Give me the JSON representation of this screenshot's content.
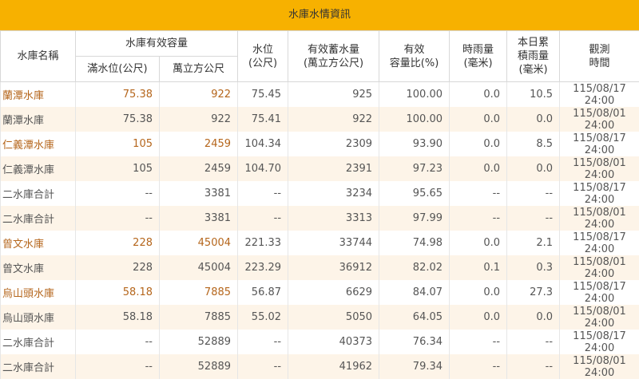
{
  "title": "水庫水情資訊",
  "headers": {
    "name": "水庫名稱",
    "capacity_group": "水庫有效容量",
    "full_level": "滿水位(公尺)",
    "capacity_volume": "萬立方公尺",
    "water_level": [
      "水位",
      "(公尺)"
    ],
    "storage": [
      "有效蓄水量",
      "(萬立方公尺)"
    ],
    "ratio": [
      "有效",
      "容量比(%)"
    ],
    "hourly_rain": [
      "時雨量",
      "(毫米)"
    ],
    "daily_rain": [
      "本日累",
      "積雨量",
      "(毫米)"
    ],
    "obs_time": [
      "觀測",
      "時間"
    ]
  },
  "rows": [
    {
      "name": "蘭潭水庫",
      "full_level": "75.38",
      "capacity": "922",
      "level": "75.45",
      "storage": "925",
      "ratio": "100.00",
      "hourly": "0.0",
      "daily": "10.5",
      "time": "115/08/17 24:00",
      "latest": true
    },
    {
      "name": "蘭潭水庫",
      "full_level": "75.38",
      "capacity": "922",
      "level": "75.41",
      "storage": "922",
      "ratio": "100.00",
      "hourly": "0.0",
      "daily": "0.0",
      "time": "115/08/01 24:00",
      "latest": false
    },
    {
      "name": "仁義潭水庫",
      "full_level": "105",
      "capacity": "2459",
      "level": "104.34",
      "storage": "2309",
      "ratio": "93.90",
      "hourly": "0.0",
      "daily": "8.5",
      "time": "115/08/17 24:00",
      "latest": true
    },
    {
      "name": "仁義潭水庫",
      "full_level": "105",
      "capacity": "2459",
      "level": "104.70",
      "storage": "2391",
      "ratio": "97.23",
      "hourly": "0.0",
      "daily": "0.0",
      "time": "115/08/01 24:00",
      "latest": false
    },
    {
      "name": "二水庫合計",
      "full_level": "--",
      "capacity": "3381",
      "level": "--",
      "storage": "3234",
      "ratio": "95.65",
      "hourly": "--",
      "daily": "--",
      "time": "115/08/17 24:00",
      "latest": false
    },
    {
      "name": "二水庫合計",
      "full_level": "--",
      "capacity": "3381",
      "level": "--",
      "storage": "3313",
      "ratio": "97.99",
      "hourly": "--",
      "daily": "--",
      "time": "115/08/01 24:00",
      "latest": false
    },
    {
      "name": "曾文水庫",
      "full_level": "228",
      "capacity": "45004",
      "level": "221.33",
      "storage": "33744",
      "ratio": "74.98",
      "hourly": "0.0",
      "daily": "2.1",
      "time": "115/08/17 24:00",
      "latest": true
    },
    {
      "name": "曾文水庫",
      "full_level": "228",
      "capacity": "45004",
      "level": "223.29",
      "storage": "36912",
      "ratio": "82.02",
      "hourly": "0.1",
      "daily": "0.3",
      "time": "115/08/01 24:00",
      "latest": false
    },
    {
      "name": "烏山頭水庫",
      "full_level": "58.18",
      "capacity": "7885",
      "level": "56.87",
      "storage": "6629",
      "ratio": "84.07",
      "hourly": "0.0",
      "daily": "27.3",
      "time": "115/08/17 24:00",
      "latest": true
    },
    {
      "name": "烏山頭水庫",
      "full_level": "58.18",
      "capacity": "7885",
      "level": "55.02",
      "storage": "5050",
      "ratio": "64.05",
      "hourly": "0.0",
      "daily": "0.0",
      "time": "115/08/01 24:00",
      "latest": false
    },
    {
      "name": "二水庫合計",
      "full_level": "--",
      "capacity": "52889",
      "level": "--",
      "storage": "40373",
      "ratio": "76.34",
      "hourly": "--",
      "daily": "--",
      "time": "115/08/17 24:00",
      "latest": false
    },
    {
      "name": "二水庫合計",
      "full_level": "--",
      "capacity": "52889",
      "level": "--",
      "storage": "41962",
      "ratio": "79.34",
      "hourly": "--",
      "daily": "--",
      "time": "115/08/01 24:00",
      "latest": false
    }
  ]
}
